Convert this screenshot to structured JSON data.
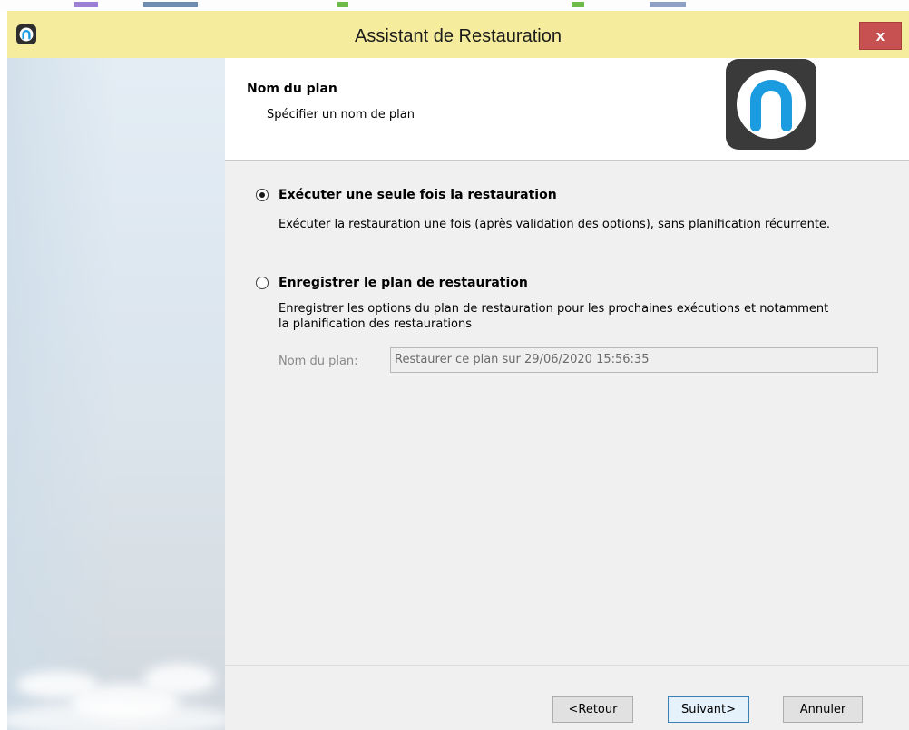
{
  "window": {
    "title": "Assistant de Restauration",
    "close_glyph": "x",
    "icon": "app-logo-icon"
  },
  "header": {
    "title": "Nom du plan",
    "subtitle": "Spécifier un nom de plan",
    "logo_icon": "app-logo-icon"
  },
  "options": [
    {
      "label": "Exécuter une seule fois la restauration",
      "description": "Exécuter la restauration une fois (après validation des options), sans planification récurrente.",
      "selected": true
    },
    {
      "label": "Enregistrer le plan de restauration",
      "description": "Enregistrer les options du plan de restauration pour les prochaines exécutions et notamment la planification des restaurations",
      "selected": false
    }
  ],
  "plan_name": {
    "label": "Nom du plan:",
    "value": "Restaurer ce plan sur 29/06/2020 15:56:35",
    "enabled": false
  },
  "buttons": {
    "back": "<Retour",
    "next": "Suivant>",
    "cancel": "Annuler"
  },
  "colors": {
    "titlebar": "#f6ec9e",
    "close": "#c75050",
    "logo_blue": "#1b9be0",
    "logo_bg": "#3a3a3a"
  }
}
